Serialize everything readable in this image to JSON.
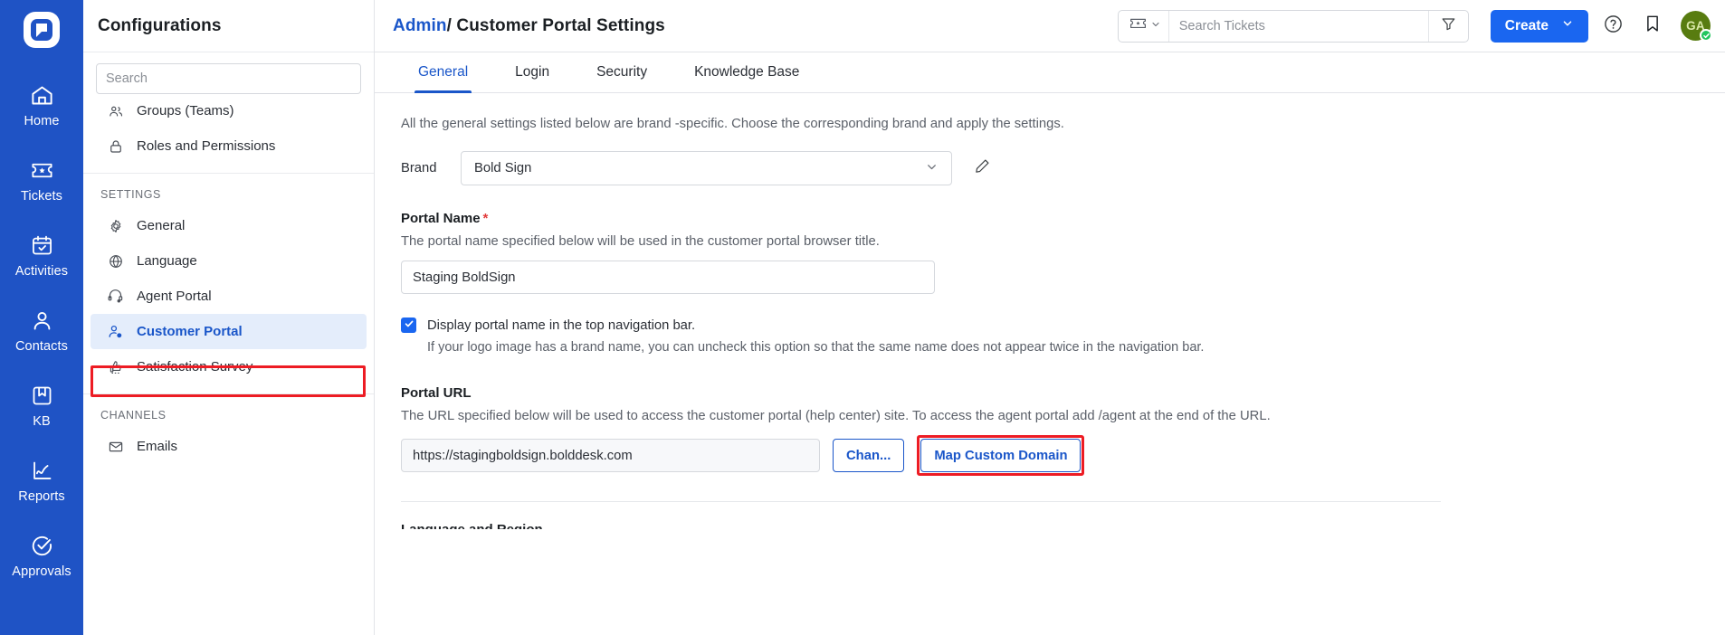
{
  "app": {
    "logo_icon": "bolddesk-logo-icon"
  },
  "rail": {
    "items": [
      {
        "label": "Home",
        "icon": "home-icon"
      },
      {
        "label": "Tickets",
        "icon": "ticket-icon"
      },
      {
        "label": "Activities",
        "icon": "calendar-check-icon"
      },
      {
        "label": "Contacts",
        "icon": "person-icon"
      },
      {
        "label": "KB",
        "icon": "book-icon"
      },
      {
        "label": "Reports",
        "icon": "chart-line-icon"
      },
      {
        "label": "Approvals",
        "icon": "check-circle-icon"
      }
    ]
  },
  "configurations": {
    "title": "Configurations",
    "collapse_icon": "chevron-left-icon",
    "search_placeholder": "Search",
    "search_value": "",
    "items_top": [
      {
        "label": "Groups (Teams)",
        "icon": "group-icon"
      },
      {
        "label": "Roles and Permissions",
        "icon": "lock-icon"
      }
    ],
    "group_settings_label": "SETTINGS",
    "items_settings": [
      {
        "label": "General",
        "icon": "gear-icon"
      },
      {
        "label": "Language",
        "icon": "globe-icon"
      },
      {
        "label": "Agent Portal",
        "icon": "headset-gear-icon"
      },
      {
        "label": "Customer Portal",
        "icon": "person-gear-icon"
      },
      {
        "label": "Satisfaction Survey",
        "icon": "thumbs-up-icon"
      }
    ],
    "active_item": "Customer Portal",
    "group_channels_label": "CHANNELS",
    "items_channels": [
      {
        "label": "Emails",
        "icon": "envelope-icon"
      }
    ]
  },
  "topbar": {
    "breadcrumb_parent": "Admin",
    "breadcrumb_separator": "/ ",
    "breadcrumb_current": "Customer Portal Settings",
    "search": {
      "type_icon": "ticket-icon",
      "type_chevron_icon": "chevron-down-icon",
      "placeholder": "Search Tickets",
      "value": "",
      "filter_icon": "filter-icon"
    },
    "create_label": "Create",
    "create_chevron_icon": "chevron-down-icon",
    "help_icon": "question-circle-icon",
    "bookmark_icon": "bookmark-icon",
    "avatar_initials": "GA",
    "avatar_status_icon": "check-badge-icon"
  },
  "tabs": [
    {
      "label": "General",
      "active": true
    },
    {
      "label": "Login",
      "active": false
    },
    {
      "label": "Security",
      "active": false
    },
    {
      "label": "Knowledge Base",
      "active": false
    }
  ],
  "content": {
    "lead": "All the general settings listed below are brand -specific. Choose the corresponding brand and apply the settings.",
    "brand": {
      "label": "Brand",
      "value": "Bold Sign",
      "chevron_icon": "chevron-down-icon",
      "edit_icon": "pencil-icon"
    },
    "portal_name": {
      "title": "Portal Name",
      "required_mark": "*",
      "description": "The portal name specified below will be used in the customer portal browser title.",
      "value": "Staging BoldSign"
    },
    "display_name_checkbox": {
      "checked": true,
      "check_icon": "checkmark-icon",
      "label": "Display portal name in the top navigation bar.",
      "hint": "If your logo image has a brand name, you can uncheck this option so that the same name does not appear twice in the navigation bar."
    },
    "portal_url": {
      "title": "Portal URL",
      "description": "The URL specified below will be used to access the customer portal (help center) site. To access the agent portal add /agent at the end of the URL.",
      "value": "https://stagingboldsign.bolddesk.com",
      "change_label": "Chan...",
      "map_domain_label": "Map Custom Domain"
    },
    "next_section_title": "Language and Region"
  },
  "colors": {
    "rail_blue": "#1f53c5",
    "accent_blue": "#1a56c9",
    "create_blue": "#1a66f0",
    "highlight_red": "#ed1c24",
    "active_item_bg": "#e4edfb",
    "avatar_green": "#587c10",
    "status_green": "#22c55e"
  }
}
